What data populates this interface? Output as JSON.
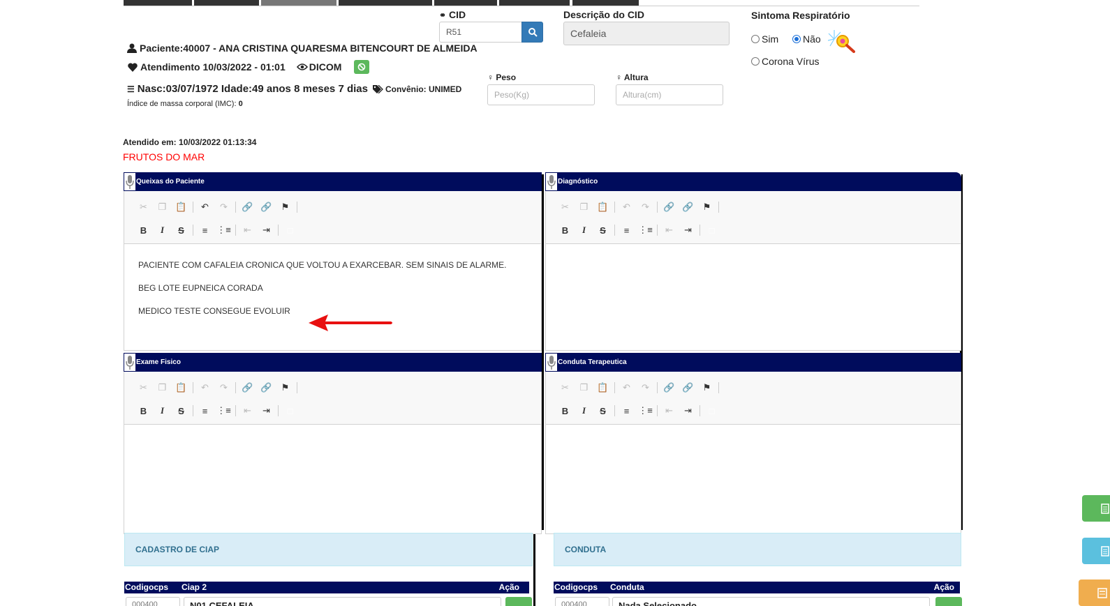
{
  "patient": {
    "name_line": "Paciente:40007 - ANA CRISTINA QUARESMA BITENCOURT DE ALMEIDA",
    "attendance_line": "Atendimento 10/03/2022 - 01:01",
    "dicom_label": "DICOM",
    "birth_line": "Nasc:03/07/1972 Idade:49 anos 8 meses 7 dias",
    "insurance_line": "Convênio: UNIMED",
    "imc_label": "Índice de massa corporal (IMC):",
    "imc_value": "0"
  },
  "cid": {
    "label": "CID",
    "value": "R51",
    "description_label": "Descrição do CID",
    "description_value": "Cefaleia"
  },
  "symptom": {
    "title": "Sintoma Respiratório",
    "options": [
      "Sim",
      "Não",
      "Corona Vírus"
    ],
    "selected": "Não"
  },
  "measures": {
    "weight_label": "Peso",
    "weight_placeholder": "Peso(Kg)",
    "height_label": "Altura",
    "height_placeholder": "Altura(cm)"
  },
  "attended": {
    "label": "Atendido em:",
    "value": "10/03/2022 01:13:34",
    "alert": "FRUTOS DO MAR"
  },
  "panels": {
    "queixas": {
      "title": "Queixas do Paciente",
      "lines": [
        "PACIENTE COM CAFALEIA CRONICA QUE VOLTOU A EXARCEBAR. SEM SINAIS DE ALARME.",
        "BEG LOTE EUPNEICA CORADA",
        "MEDICO TESTE CONSEGUE EVOLUIR"
      ]
    },
    "diagnostico": {
      "title": "Diagnóstico"
    },
    "exame": {
      "title": "Exame Fisico"
    },
    "conduta": {
      "title": "Conduta Terapeutica"
    }
  },
  "sections": {
    "ciap": {
      "title": "CADASTRO DE CIAP",
      "columns": [
        "Codigocps",
        "Ciap 2",
        "Ação"
      ],
      "row": {
        "code": "000400",
        "name": "N01 CEFALEIA"
      }
    },
    "conduta": {
      "title": "CONDUTA",
      "columns": [
        "Codigocps",
        "Conduta",
        "Ação"
      ],
      "row": {
        "code": "000400",
        "name": "Nada Selecionado"
      }
    }
  },
  "colors": {
    "panel_header": "#000c5c",
    "primary": "#337ab7",
    "success": "#5cb85c",
    "info_bg": "#d9edf7",
    "alert_text": "#ff0000",
    "arrow": "#e81010"
  }
}
